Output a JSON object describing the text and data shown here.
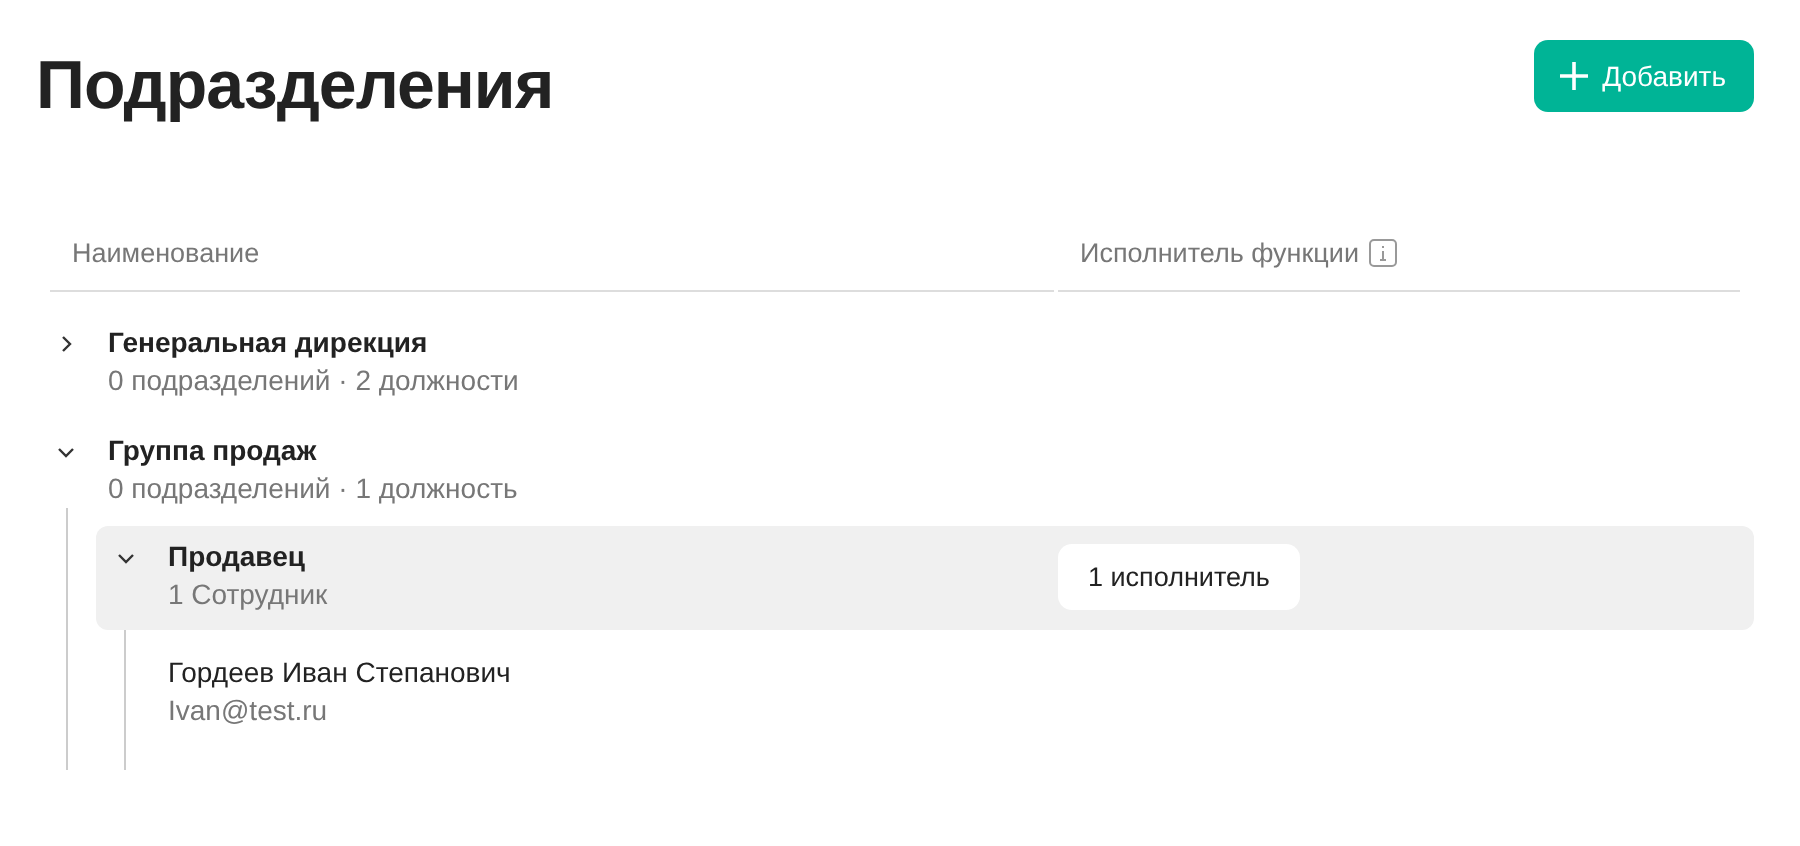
{
  "title": "Подразделения",
  "add_button": {
    "label": "Добавить"
  },
  "table": {
    "columns": [
      {
        "label": "Наименование",
        "info": false
      },
      {
        "label": "Исполнитель функции",
        "info": true
      }
    ],
    "departments": [
      {
        "name": "Генеральная дирекция",
        "summary": "0 подразделений · 2 должности",
        "expanded": false
      },
      {
        "name": "Группа продаж",
        "summary": "0 подразделений · 1 должность",
        "expanded": true,
        "positions": [
          {
            "name": "Продавец",
            "summary": "1 Сотрудник",
            "expanded": true,
            "highlighted": true,
            "executors": "1 исполнитель",
            "employees": [
              {
                "name": "Гордеев Иван Степанович",
                "email": "Ivan@test.ru"
              }
            ]
          }
        ]
      }
    ]
  }
}
